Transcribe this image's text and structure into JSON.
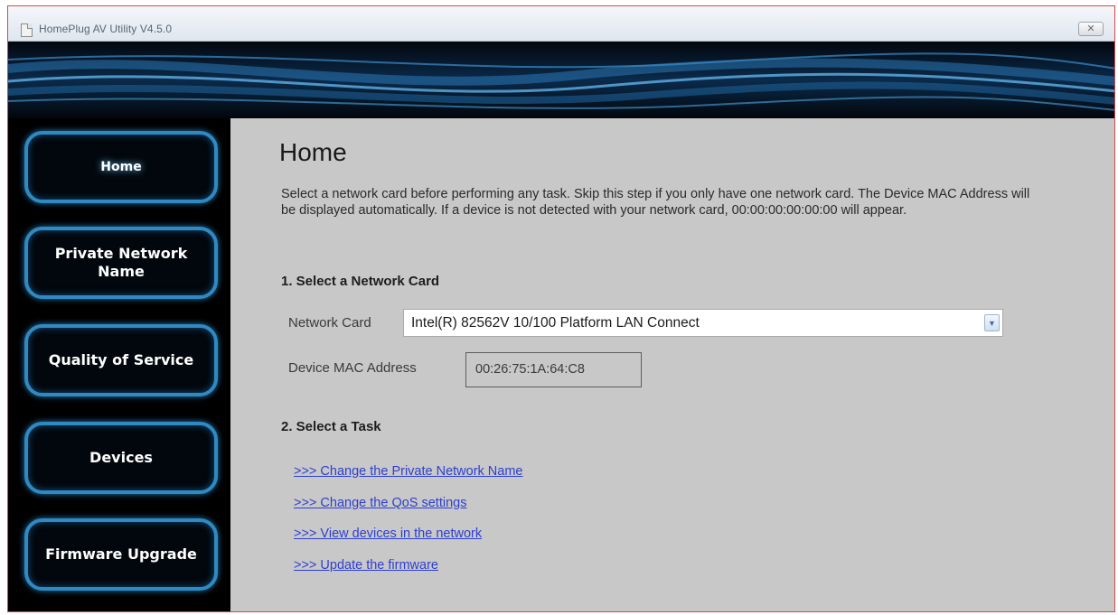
{
  "window": {
    "title": "HomePlug AV Utility V4.5.0",
    "close_label": "✕"
  },
  "sidebar": {
    "items": [
      {
        "label": "Home",
        "active": true
      },
      {
        "label": "Private Network Name",
        "active": false
      },
      {
        "label": "Quality of Service",
        "active": false
      },
      {
        "label": "Devices",
        "active": false
      },
      {
        "label": "Firmware Upgrade",
        "active": false
      }
    ]
  },
  "main": {
    "title": "Home",
    "intro": "Select a network card before performing any task. Skip this step if you only have one network card. The Device MAC Address will be displayed automatically. If a device is not detected with your network card, 00:00:00:00:00:00 will appear.",
    "section1": {
      "title": "1. Select a Network Card",
      "network_card_label": "Network Card",
      "network_card_value": "Intel(R) 82562V 10/100 Platform LAN Connect",
      "mac_label": "Device MAC Address",
      "mac_value": "00:26:75:1A:64:C8"
    },
    "section2": {
      "title": "2. Select a Task",
      "links": [
        ">>> Change the Private Network Name",
        ">>> Change the QoS settings",
        ">>> View devices in the network",
        ">>> Update the firmware"
      ]
    }
  },
  "colors": {
    "nav_border": "#2f89c2",
    "link": "#2e3fd0",
    "content_bg": "#c8c8c8"
  }
}
